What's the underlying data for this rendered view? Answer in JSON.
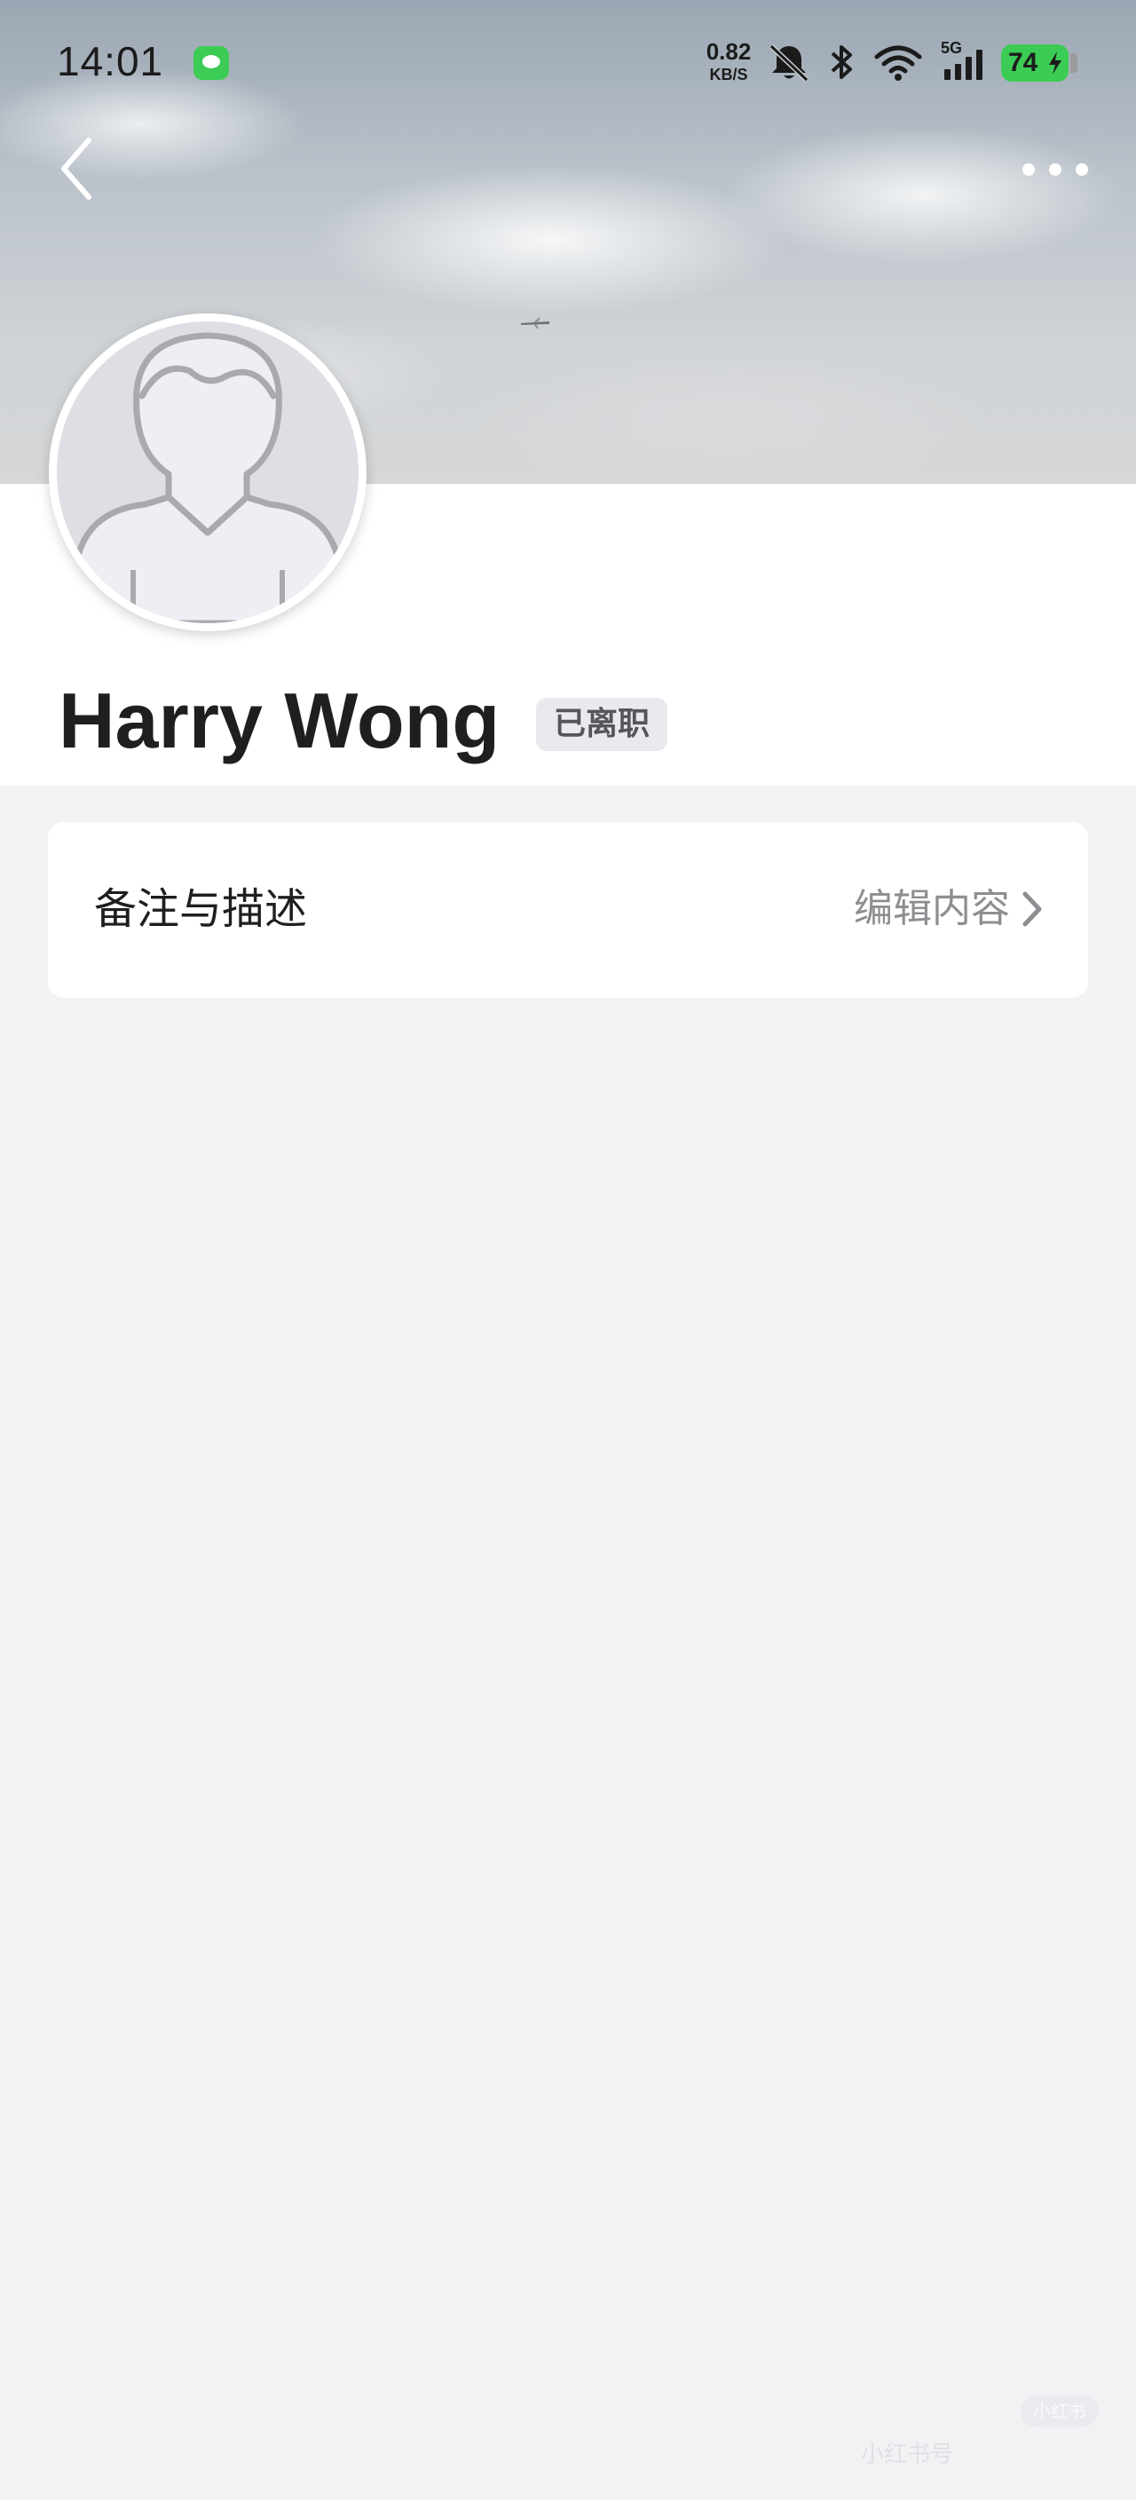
{
  "status_bar": {
    "time": "14:01",
    "net_speed_value": "0.82",
    "net_speed_unit": "KB/S",
    "signal_type": "5G",
    "battery_level": "74",
    "icons": [
      "message-app-icon",
      "mute-bell-icon",
      "bluetooth-icon",
      "wifi-icon",
      "cellular-signal-icon",
      "battery-charging-icon"
    ],
    "battery_color": "#3ccc55"
  },
  "nav": {
    "back_icon": "chevron-left-icon",
    "more_icon": "more-dots-icon"
  },
  "profile": {
    "name": "Harry Wong",
    "status_badge": "已离职",
    "avatar_icon": "default-person-avatar-icon"
  },
  "notes_row": {
    "label": "备注与描述",
    "action": "编辑内容",
    "action_icon": "chevron-right-icon"
  },
  "watermark": {
    "logo": "小红书",
    "text": "小红书号"
  }
}
